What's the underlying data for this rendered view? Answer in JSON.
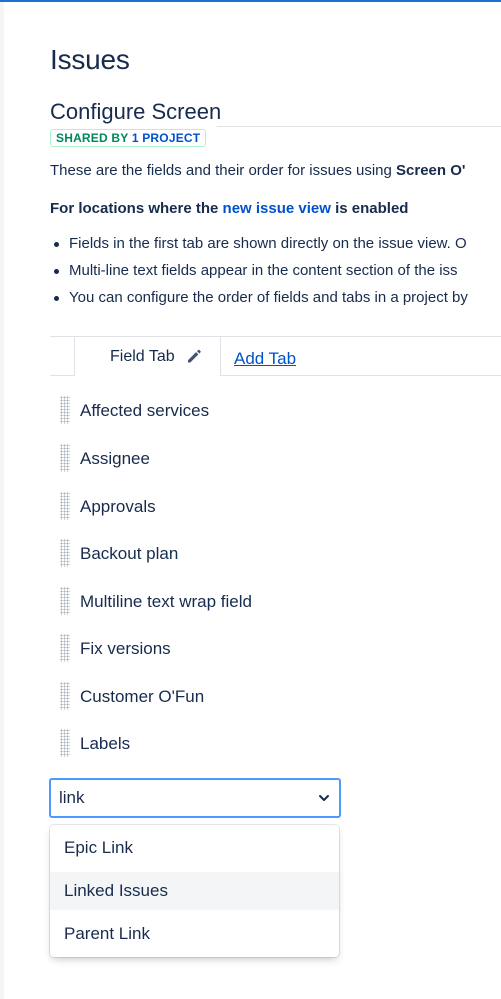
{
  "page": {
    "title": "Issues"
  },
  "screen": {
    "section_title": "Configure Screen",
    "badge": {
      "prefix": "SHARED BY",
      "link": "1 PROJECT"
    },
    "description": {
      "text": "These are the fields and their order for issues using ",
      "screen_name": "Screen O'"
    },
    "locations_heading": {
      "before": "For locations where the ",
      "link": "new issue view",
      "after": " is enabled"
    },
    "bullets": [
      "Fields in the first tab are shown directly on the issue view. O",
      "Multi-line text fields appear in the content section of the iss",
      "You can configure the order of fields and tabs in a project by"
    ]
  },
  "tabs": {
    "active_tab_label": "Field Tab",
    "active_tab_icon": "pencil-icon",
    "add_tab_label": "Add Tab"
  },
  "fields": [
    "Affected services",
    "Assignee",
    "Approvals",
    "Backout plan",
    "Multiline text wrap field",
    "Fix versions",
    "Customer O'Fun",
    "Labels"
  ],
  "add_field": {
    "value": "link",
    "icon": "chevron-down-icon",
    "options": [
      "Epic Link",
      "Linked Issues",
      "Parent Link"
    ],
    "highlighted_option": "Linked Issues"
  },
  "colors": {
    "text": "#172b4d",
    "link": "#0052cc",
    "badge_green": "#00875a",
    "focus_border": "#4c9aff",
    "hover_bg": "#f4f5f7",
    "top_bar": "#1f6fd0"
  }
}
